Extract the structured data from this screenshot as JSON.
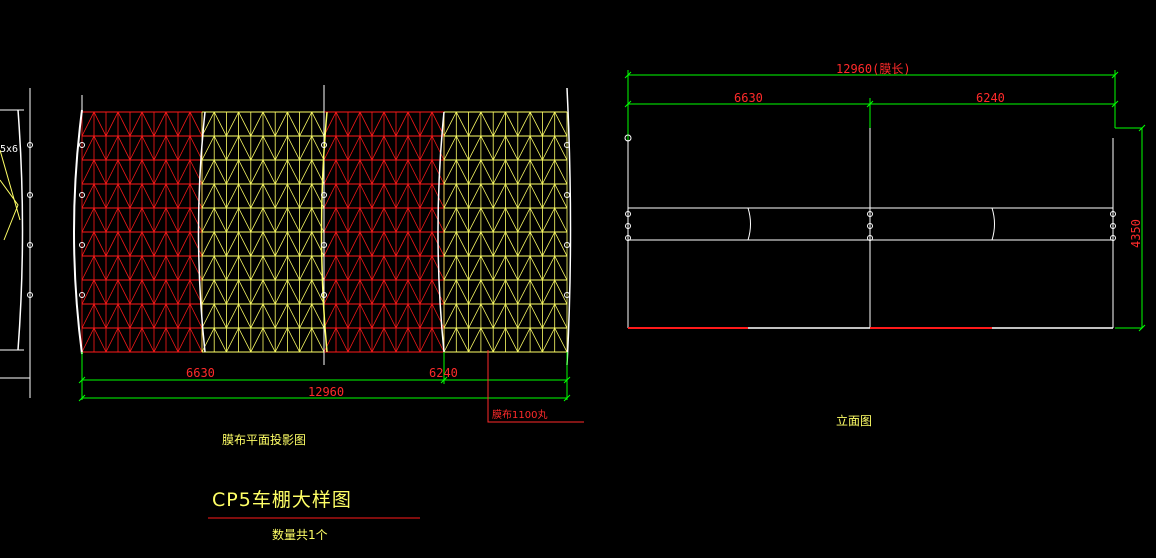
{
  "colors": {
    "background": "#000000",
    "dimension_green": "#00ff00",
    "dimension_text_red": "#ff2a2a",
    "membrane_red": "#ff1a1a",
    "membrane_yellow": "#ffff66",
    "structure_white": "#ffffff"
  },
  "plan_view": {
    "dim_left": "6630",
    "dim_right": "6240",
    "dim_total": "12960",
    "membrane_note": "膜布1100丸",
    "caption": "膜布平面投影图",
    "left_edge_label": "5x6"
  },
  "elevation_view": {
    "dim_total": "12960(膜长)",
    "dim_left": "6630",
    "dim_right": "6240",
    "dim_height": "4350",
    "caption": "立面图"
  },
  "title_block": {
    "title": "CP5车棚大样图",
    "quantity": "数量共1个"
  }
}
